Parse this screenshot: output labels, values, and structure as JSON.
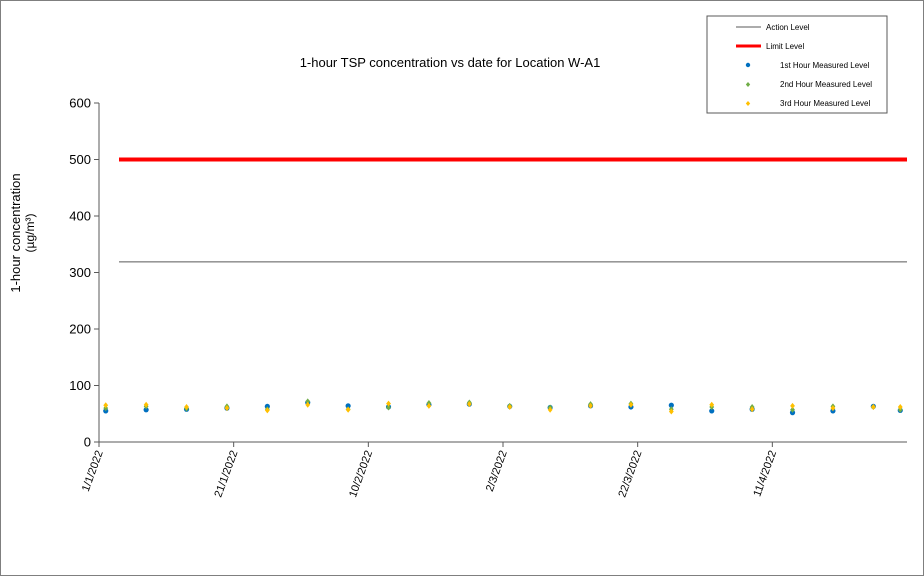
{
  "chart_data": {
    "type": "scatter",
    "title": "1-hour TSP concentration vs date for Location W-A1",
    "ylabel_line1": "1-hour concentration",
    "ylabel_line2": "(µg/m³)",
    "xlabel": "",
    "ylim": [
      0,
      600
    ],
    "yticks": [
      0,
      100,
      200,
      300,
      400,
      500,
      600
    ],
    "xlim": [
      "2022-01-01",
      "2022-05-01"
    ],
    "xticks": [
      "1/1/2022",
      "21/1/2022",
      "10/2/2022",
      "2/3/2022",
      "22/3/2022",
      "11/4/2022"
    ],
    "grid": false,
    "legend_position": "top-right",
    "reference_lines": [
      {
        "name": "Action Level",
        "value": 318.7,
        "color": "#595959"
      },
      {
        "name": "Limit Level",
        "value": 500,
        "color": "#ff0000"
      }
    ],
    "series": [
      {
        "name": "1st Hour Measured Level",
        "color": "#0070c0",
        "x": [
          "2022-01-02",
          "2022-01-08",
          "2022-01-14",
          "2022-01-20",
          "2022-01-26",
          "2022-02-01",
          "2022-02-07",
          "2022-02-13",
          "2022-02-19",
          "2022-02-25",
          "2022-03-03",
          "2022-03-09",
          "2022-03-15",
          "2022-03-21",
          "2022-03-27",
          "2022-04-02",
          "2022-04-08",
          "2022-04-14",
          "2022-04-20",
          "2022-04-26",
          "2022-04-30"
        ],
        "y": [
          55,
          57,
          58,
          60,
          63,
          70,
          64,
          62,
          66,
          67,
          63,
          61,
          64,
          62,
          65,
          55,
          58,
          52,
          55,
          63,
          56
        ]
      },
      {
        "name": "2nd Hour Measured Level",
        "color": "#70ad47",
        "x": [
          "2022-01-02",
          "2022-01-08",
          "2022-01-14",
          "2022-01-20",
          "2022-01-26",
          "2022-02-01",
          "2022-02-07",
          "2022-02-13",
          "2022-02-19",
          "2022-02-25",
          "2022-03-03",
          "2022-03-09",
          "2022-03-15",
          "2022-03-21",
          "2022-03-27",
          "2022-04-02",
          "2022-04-08",
          "2022-04-14",
          "2022-04-20",
          "2022-04-26",
          "2022-04-30"
        ],
        "y": [
          60,
          63,
          59,
          63,
          58,
          72,
          58,
          61,
          69,
          70,
          64,
          61,
          67,
          68,
          58,
          62,
          62,
          57,
          63,
          62,
          57
        ]
      },
      {
        "name": "3rd Hour Measured Level",
        "color": "#ffc000",
        "x": [
          "2022-01-02",
          "2022-01-08",
          "2022-01-14",
          "2022-01-20",
          "2022-01-26",
          "2022-02-01",
          "2022-02-07",
          "2022-02-13",
          "2022-02-19",
          "2022-02-25",
          "2022-03-03",
          "2022-03-09",
          "2022-03-15",
          "2022-03-21",
          "2022-03-27",
          "2022-04-02",
          "2022-04-08",
          "2022-04-14",
          "2022-04-20",
          "2022-04-26",
          "2022-04-30"
        ],
        "y": [
          65,
          66,
          62,
          60,
          56,
          66,
          57,
          68,
          64,
          67,
          62,
          57,
          64,
          66,
          54,
          66,
          58,
          64,
          60,
          62,
          62
        ]
      }
    ]
  }
}
